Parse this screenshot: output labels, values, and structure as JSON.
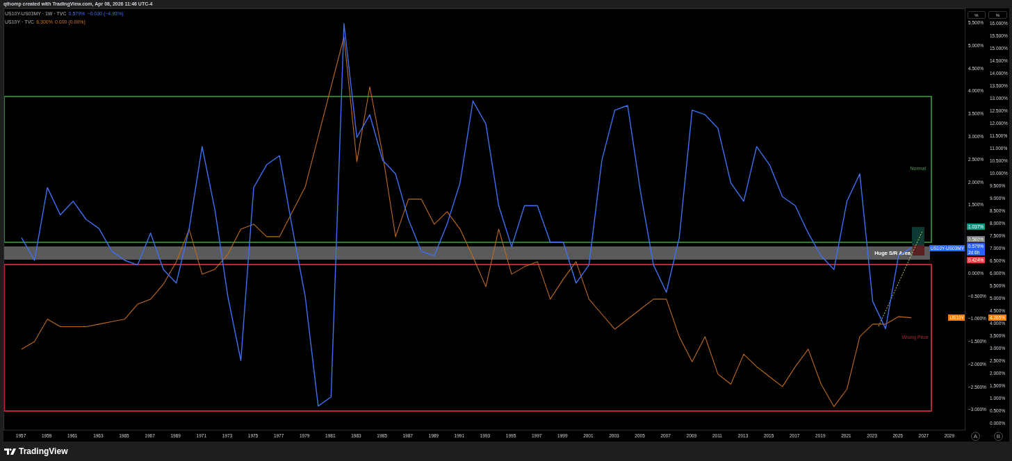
{
  "header": {
    "text": "qthomp created with TradingView.com, Apr 08, 2026 11:46 UTC-4"
  },
  "legend": [
    {
      "name": "US10Y-US03MY · 1W · TVC",
      "value": "0.579%",
      "change": "−0.030 (−4.93%)"
    },
    {
      "name": "US10Y · TVC",
      "value": "6.300%",
      "change": "0.000 (0.00%)"
    }
  ],
  "panes": [
    {
      "chart_data": {
        "type": "line",
        "xlim": [
          1955.65,
          2030.3
        ],
        "ylim": [
          -3.45,
          5.82
        ],
        "x": [
          1957,
          1958,
          1959,
          1960,
          1961,
          1962,
          1963,
          1964,
          1965,
          1966,
          1967,
          1968,
          1969,
          1970,
          1971,
          1972,
          1973,
          1974,
          1975,
          1976,
          1977,
          1978,
          1979,
          1980,
          1981,
          1982,
          1983,
          1984,
          1985,
          1986,
          1987,
          1988,
          1989,
          1990,
          1991,
          1992,
          1993,
          1994,
          1995,
          1996,
          1997,
          1998,
          1999,
          2000,
          2001,
          2002,
          2003,
          2004,
          2005,
          2006,
          2007,
          2008,
          2009,
          2010,
          2011,
          2012,
          2013,
          2014,
          2015,
          2016,
          2017,
          2018,
          2019,
          2020,
          2021,
          2022,
          2023,
          2024,
          2025,
          2026
        ],
        "xticks": [
          {
            "value": 1957,
            "label": "1957"
          },
          {
            "value": 1959,
            "label": "1959"
          },
          {
            "value": 1961,
            "label": "1961"
          },
          {
            "value": 1963,
            "label": "1963"
          },
          {
            "value": 1965,
            "label": "1965"
          },
          {
            "value": 1967,
            "label": "1967"
          },
          {
            "value": 1969,
            "label": "1969"
          },
          {
            "value": 1971,
            "label": "1971"
          },
          {
            "value": 1973,
            "label": "1973"
          },
          {
            "value": 1975,
            "label": "1975"
          },
          {
            "value": 1977,
            "label": "1977"
          },
          {
            "value": 1979,
            "label": "1979"
          },
          {
            "value": 1981,
            "label": "1981"
          },
          {
            "value": 1983,
            "label": "1983"
          },
          {
            "value": 1985,
            "label": "1985"
          },
          {
            "value": 1987,
            "label": "1987"
          },
          {
            "value": 1989,
            "label": "1989"
          },
          {
            "value": 1991,
            "label": "1991"
          },
          {
            "value": 1993,
            "label": "1993"
          },
          {
            "value": 1995,
            "label": "1995"
          },
          {
            "value": 1997,
            "label": "1997"
          },
          {
            "value": 1999,
            "label": "1999"
          },
          {
            "value": 2001,
            "label": "2001"
          },
          {
            "value": 2003,
            "label": "2003"
          },
          {
            "value": 2005,
            "label": "2005"
          },
          {
            "value": 2007,
            "label": "2007"
          },
          {
            "value": 2009,
            "label": "2009"
          },
          {
            "value": 2011,
            "label": "2011"
          },
          {
            "value": 2013,
            "label": "2013"
          },
          {
            "value": 2015,
            "label": "2015"
          },
          {
            "value": 2017,
            "label": "2017"
          },
          {
            "value": 2019,
            "label": "2019"
          },
          {
            "value": 2021,
            "label": "2021"
          },
          {
            "value": 2023,
            "label": "2023"
          },
          {
            "value": 2025,
            "label": "2025"
          },
          {
            "value": 2027,
            "label": "2027"
          },
          {
            "value": 2029,
            "label": "2029"
          }
        ],
        "yticks": [
          {
            "value": 5.5,
            "label": "5.500%"
          },
          {
            "value": 5,
            "label": "5.000%"
          },
          {
            "value": 4.5,
            "label": "4.500%"
          },
          {
            "value": 4,
            "label": "4.000%"
          },
          {
            "value": 3.5,
            "label": "3.500%"
          },
          {
            "value": 3,
            "label": "3.000%"
          },
          {
            "value": 2.5,
            "label": "2.500%"
          },
          {
            "value": 2,
            "label": "2.000%"
          },
          {
            "value": 1.5,
            "label": "1.500%"
          },
          {
            "value": 0,
            "label": "0.000%"
          },
          {
            "value": -0.5,
            "label": "−0.500%"
          },
          {
            "value": -1,
            "label": "−1.000%"
          },
          {
            "value": -1.5,
            "label": "−1.500%"
          },
          {
            "value": -2,
            "label": "−2.000%"
          },
          {
            "value": -2.5,
            "label": "−2.500%"
          },
          {
            "value": -3,
            "label": "−3.000%"
          }
        ],
        "series": [
          {
            "name": "US10Y-US03MY",
            "color": "#3f70f2",
            "values": [
              0.8,
              0.3,
              1.9,
              1.3,
              1.6,
              1.2,
              1.0,
              0.5,
              0.3,
              0.2,
              0.9,
              0.1,
              -0.2,
              1.0,
              2.8,
              1.4,
              -0.5,
              -1.9,
              1.9,
              2.4,
              2.6,
              1.0,
              -0.5,
              -2.9,
              -2.7,
              5.5,
              3.0,
              3.5,
              2.5,
              2.2,
              1.2,
              0.5,
              0.4,
              1.1,
              2.0,
              3.8,
              3.3,
              1.5,
              0.6,
              1.5,
              1.5,
              0.7,
              0.7,
              -0.2,
              0.2,
              2.5,
              3.6,
              3.7,
              1.8,
              0.2,
              -0.4,
              0.8,
              3.6,
              3.5,
              3.2,
              2.0,
              1.6,
              2.8,
              2.4,
              1.7,
              1.5,
              0.9,
              0.4,
              0.1,
              1.6,
              2.2,
              -0.6,
              -1.2,
              0.4,
              0.58
            ]
          }
        ]
      }
    },
    {
      "chart_data": {
        "type": "line",
        "x": [
          1957,
          1958,
          1959,
          1960,
          1961,
          1962,
          1963,
          1964,
          1965,
          1966,
          1967,
          1968,
          1969,
          1970,
          1971,
          1972,
          1973,
          1974,
          1975,
          1976,
          1977,
          1978,
          1979,
          1980,
          1981,
          1982,
          1983,
          1984,
          1985,
          1986,
          1987,
          1988,
          1989,
          1990,
          1991,
          1992,
          1993,
          1994,
          1995,
          1996,
          1997,
          1998,
          1999,
          2000,
          2001,
          2002,
          2003,
          2004,
          2005,
          2006,
          2007,
          2008,
          2009,
          2010,
          2011,
          2012,
          2013,
          2014,
          2015,
          2016,
          2017,
          2018,
          2019,
          2020,
          2021,
          2022,
          2023,
          2024,
          2025,
          2026
        ],
        "xlim": [
          1955.65,
          2030.3
        ],
        "ylim": [
          -0.28,
          16.61
        ],
        "yticks": [
          {
            "value": 16,
            "label": "16.000%"
          },
          {
            "value": 15.5,
            "label": "15.500%"
          },
          {
            "value": 15,
            "label": "15.000%"
          },
          {
            "value": 14.5,
            "label": "14.500%"
          },
          {
            "value": 14,
            "label": "14.000%"
          },
          {
            "value": 13.5,
            "label": "13.500%"
          },
          {
            "value": 13,
            "label": "13.000%"
          },
          {
            "value": 12.5,
            "label": "12.500%"
          },
          {
            "value": 12,
            "label": "12.000%"
          },
          {
            "value": 11.5,
            "label": "11.500%"
          },
          {
            "value": 11,
            "label": "11.000%"
          },
          {
            "value": 10.5,
            "label": "10.500%"
          },
          {
            "value": 10,
            "label": "10.000%"
          },
          {
            "value": 9.5,
            "label": "9.500%"
          },
          {
            "value": 9,
            "label": "9.000%"
          },
          {
            "value": 8.5,
            "label": "8.500%"
          },
          {
            "value": 8,
            "label": "8.000%"
          },
          {
            "value": 7.5,
            "label": "7.500%"
          },
          {
            "value": 7,
            "label": "7.000%"
          },
          {
            "value": 6.5,
            "label": "6.500%"
          },
          {
            "value": 6,
            "label": "6.000%"
          },
          {
            "value": 5.5,
            "label": "5.500%"
          },
          {
            "value": 5,
            "label": "5.000%"
          },
          {
            "value": 4.5,
            "label": "4.500%"
          },
          {
            "value": 4,
            "label": "4.000%"
          },
          {
            "value": 3.5,
            "label": "3.500%"
          },
          {
            "value": 3,
            "label": "3.000%"
          },
          {
            "value": 2.5,
            "label": "2.500%"
          },
          {
            "value": 2,
            "label": "2.000%"
          },
          {
            "value": 1.5,
            "label": "1.500%"
          },
          {
            "value": 1,
            "label": "1.000%"
          },
          {
            "value": 0.5,
            "label": "0.500%"
          },
          {
            "value": 0,
            "label": "0.000%"
          }
        ],
        "series": [
          {
            "name": "US10Y",
            "color": "#c06a1e",
            "values": [
              3.0,
              3.3,
              4.2,
              3.9,
              3.9,
              3.9,
              4.0,
              4.1,
              4.2,
              4.8,
              5.0,
              5.6,
              6.5,
              7.8,
              6.0,
              6.2,
              6.8,
              7.8,
              8.0,
              7.5,
              7.5,
              8.5,
              9.5,
              11.5,
              13.5,
              15.5,
              10.5,
              13.5,
              10.8,
              7.5,
              9.0,
              9.0,
              8.0,
              8.5,
              7.8,
              6.7,
              5.5,
              7.8,
              6.0,
              6.3,
              6.5,
              5.0,
              5.8,
              6.5,
              5.0,
              4.4,
              3.8,
              4.2,
              4.6,
              5.0,
              5.0,
              3.5,
              2.5,
              3.5,
              2.0,
              1.6,
              2.8,
              2.3,
              1.9,
              1.5,
              2.3,
              3.0,
              1.6,
              0.7,
              1.4,
              3.5,
              4.0,
              4.0,
              4.3,
              4.26
            ]
          }
        ]
      }
    }
  ],
  "scale_buttons": [
    "%",
    "%"
  ],
  "price_labels": [
    {
      "kind": "target",
      "text": "1.037%",
      "color": "#089981"
    },
    {
      "kind": "high",
      "text": "0.580%",
      "color": "#787b86"
    },
    {
      "kind": "last",
      "text": "0.579%",
      "countdown": "2d 6h",
      "color": "#2962ff"
    },
    {
      "kind": "stop",
      "text": "0.424%",
      "color": "#f23645"
    }
  ],
  "series_tags": [
    {
      "color": "#2962ff"
    },
    {
      "color": "#f57c00"
    }
  ],
  "us10y_label": {
    "text": "4.265%",
    "color": "#f57c00"
  },
  "zones": [
    {
      "kind": "normal",
      "label": "Normal",
      "color": "#2e7d32"
    },
    {
      "kind": "sr",
      "label": "Huge S/R Area",
      "color": "#5a5a5a"
    },
    {
      "kind": "wrong",
      "label": "Wrong Price",
      "color": "#b22833"
    }
  ],
  "axis_buttons": [
    "A",
    "B"
  ],
  "footer": {
    "brand": "TradingView"
  }
}
